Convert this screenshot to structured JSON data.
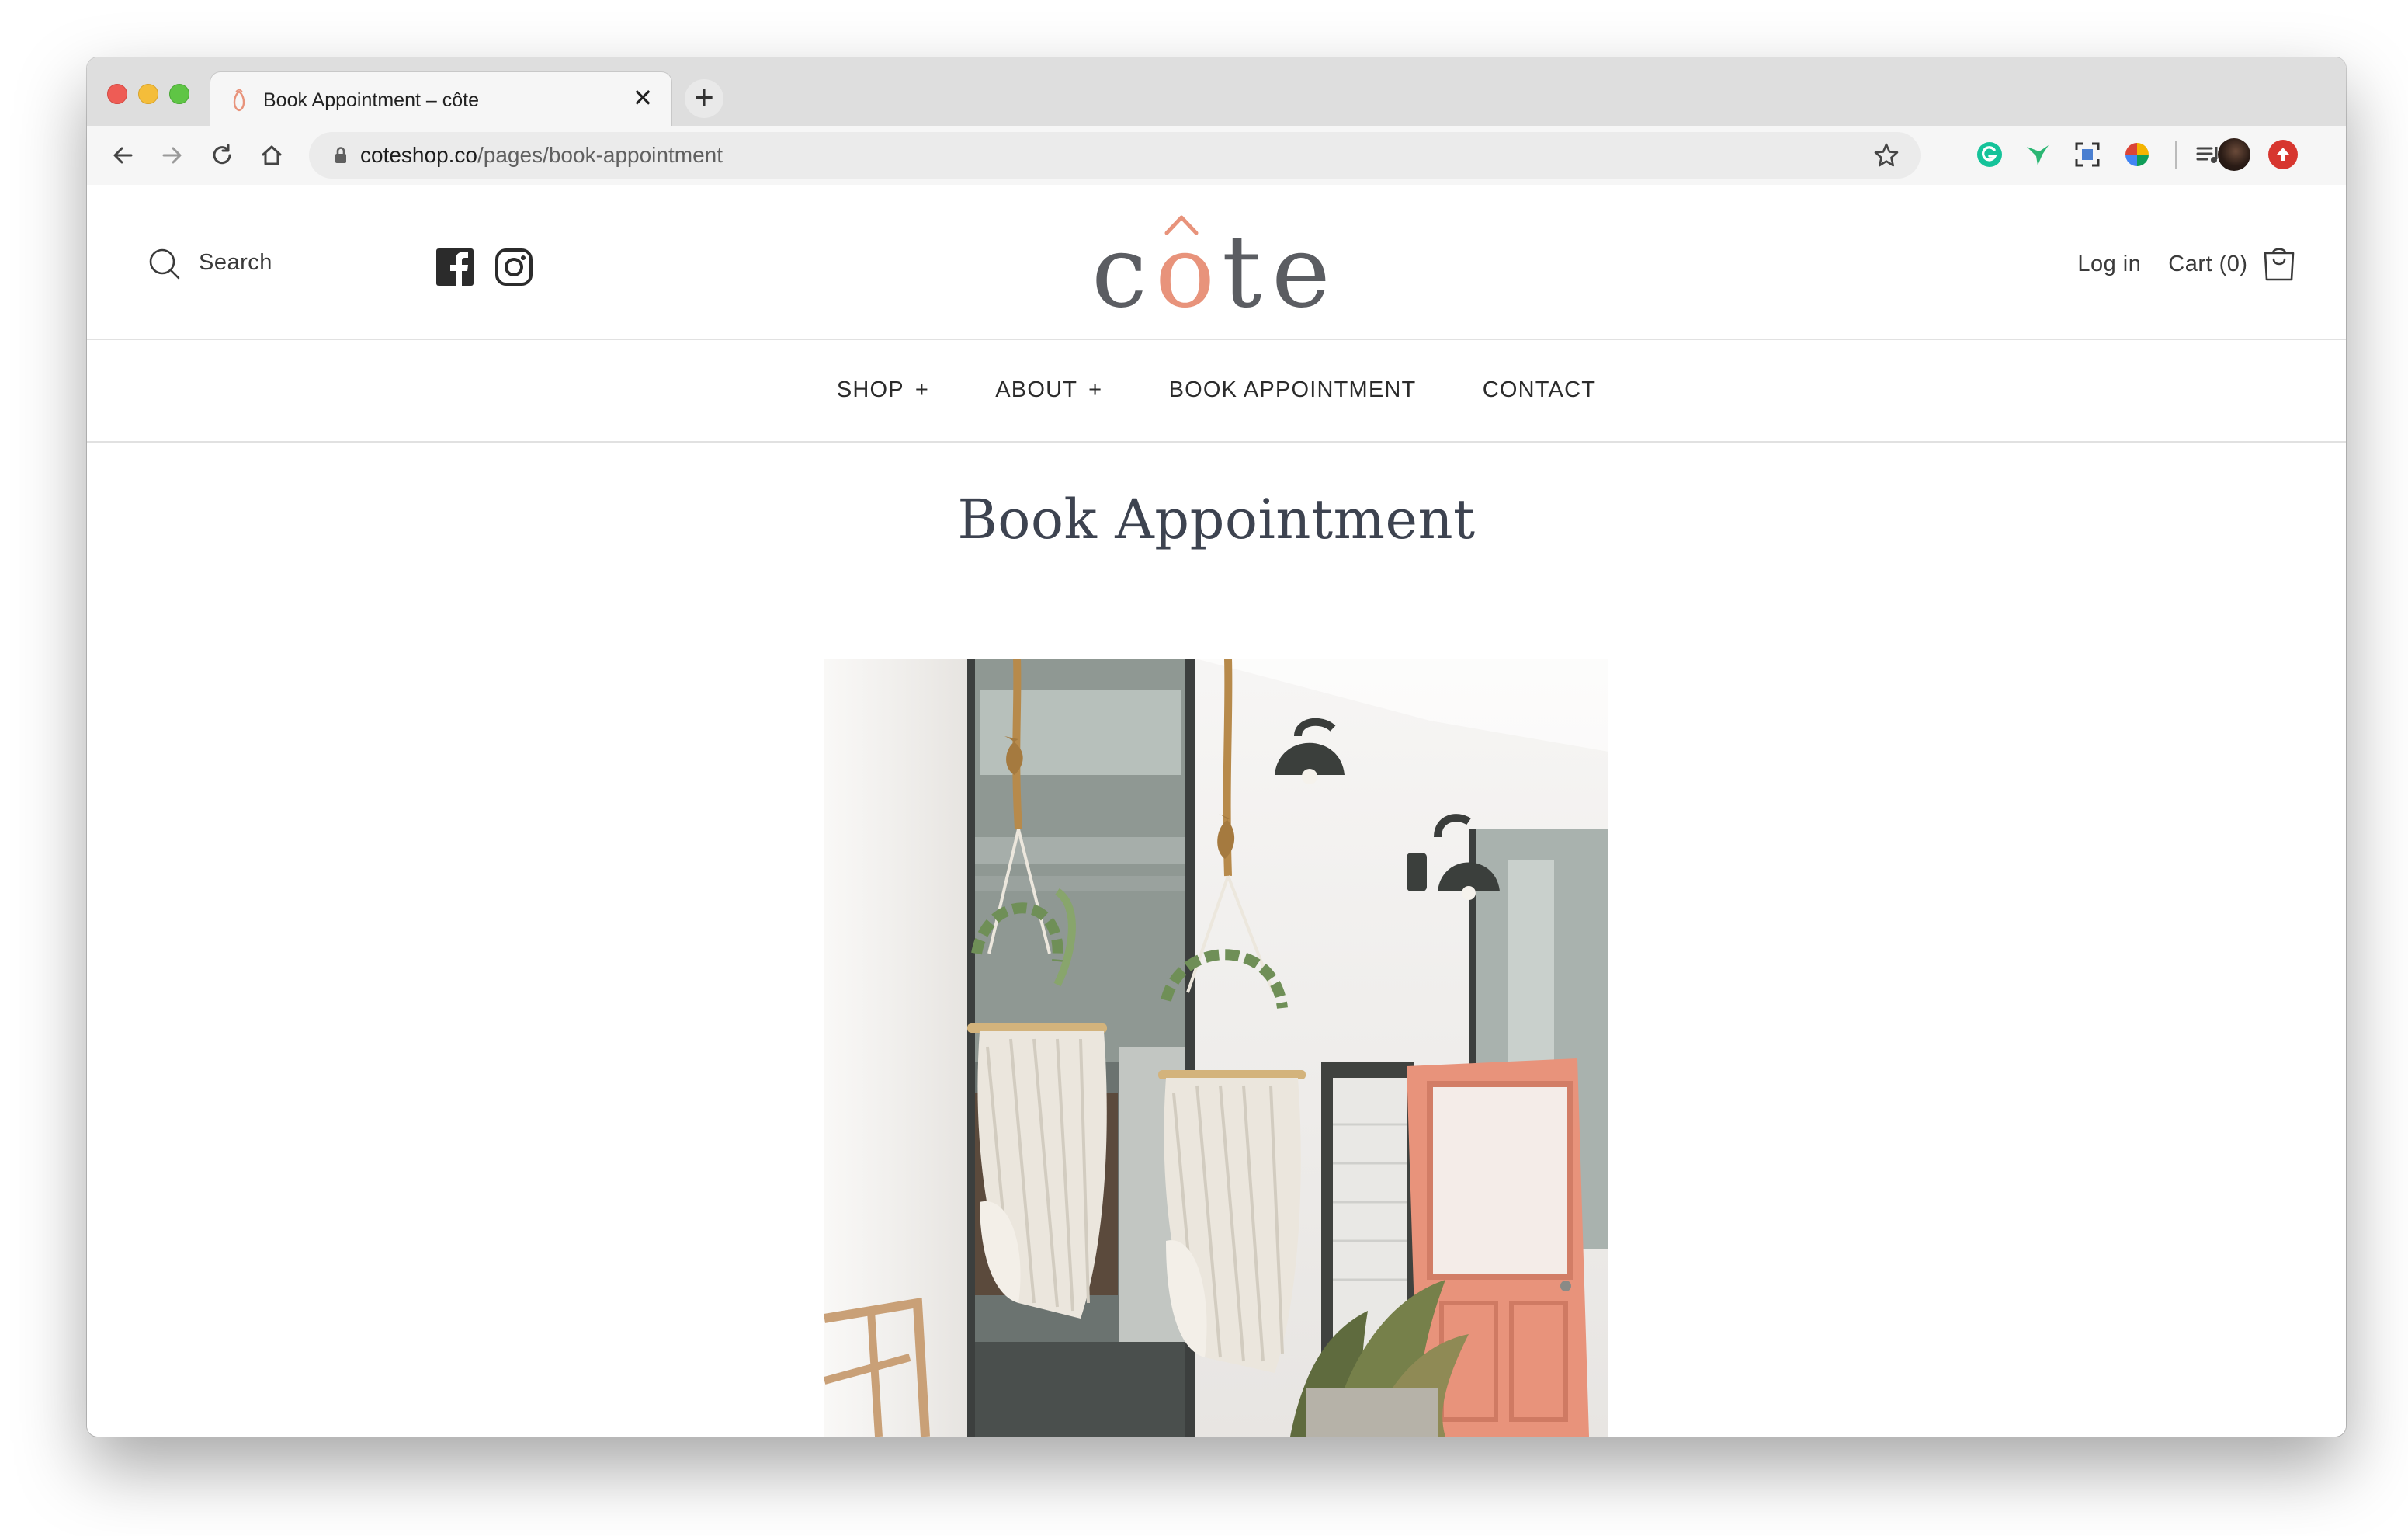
{
  "browser": {
    "tab_title": "Book Appointment – côte",
    "tab_close": "✕",
    "new_tab": "+",
    "url_host": "coteshop.co",
    "url_path": "/pages/book-appointment"
  },
  "header": {
    "search_label": "Search",
    "logo_text": "côte",
    "login_label": "Log in",
    "cart_label": "Cart (0)",
    "brand_colors": {
      "logo_gray": "#5b5d62",
      "logo_accent": "#e8937b"
    }
  },
  "nav": {
    "items": [
      {
        "label": "SHOP",
        "plus": "+"
      },
      {
        "label": "ABOUT",
        "plus": "+"
      },
      {
        "label": "BOOK APPOINTMENT"
      },
      {
        "label": "CONTACT"
      }
    ]
  },
  "main": {
    "title": "Book Appointment",
    "hero_image": "storefront-hammock-chairs-photo"
  },
  "icons": {
    "back": "back-arrow-icon",
    "forward": "forward-arrow-icon",
    "reload": "reload-icon",
    "home": "home-icon",
    "lock": "lock-icon",
    "bookmark": "star-icon",
    "search": "search-icon",
    "facebook": "facebook-icon",
    "instagram": "instagram-icon",
    "cart": "shopping-bag-icon"
  }
}
